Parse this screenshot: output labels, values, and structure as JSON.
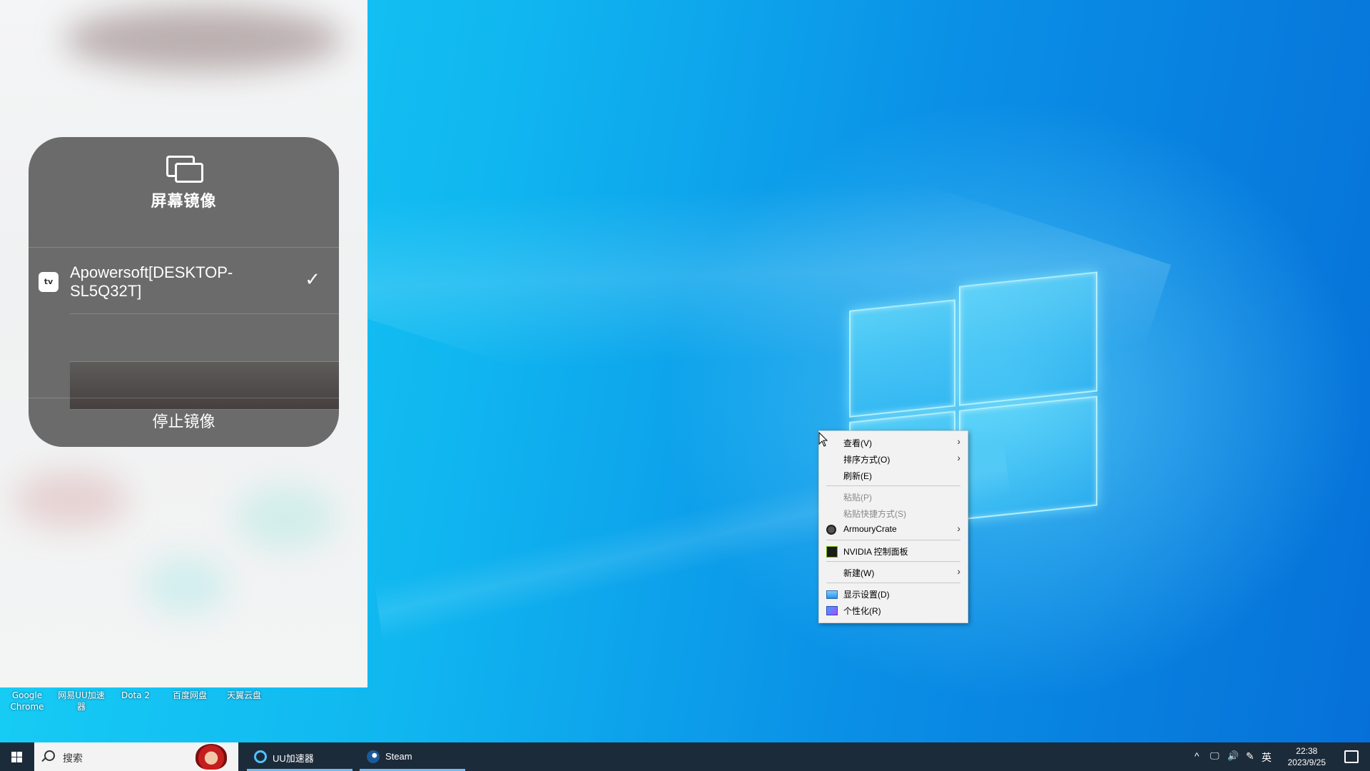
{
  "mirroring": {
    "title": "屏幕镜像",
    "tv_badge": "tv",
    "device_name": "Apowersoft[DESKTOP-SL5Q32T]",
    "check": "✓",
    "stop_label": "停止镜像"
  },
  "desktop_icons": [
    {
      "label": "Google\nChrome"
    },
    {
      "label": "网易UU加速\n器"
    },
    {
      "label": "Dota 2"
    },
    {
      "label": "百度网盘"
    },
    {
      "label": "天翼云盘"
    }
  ],
  "context_menu": {
    "items": [
      {
        "label": "查看(V)",
        "submenu": true,
        "enabled": true
      },
      {
        "label": "排序方式(O)",
        "submenu": true,
        "enabled": true
      },
      {
        "label": "刷新(E)",
        "submenu": false,
        "enabled": true
      },
      {
        "label": "粘贴(P)",
        "submenu": false,
        "enabled": false
      },
      {
        "label": "粘贴快捷方式(S)",
        "submenu": false,
        "enabled": false
      },
      {
        "label": "ArmouryCrate",
        "submenu": true,
        "enabled": true,
        "icon": "armourycrate-icon"
      },
      {
        "label": "NVIDIA 控制面板",
        "submenu": false,
        "enabled": true,
        "icon": "nvidia-icon"
      },
      {
        "label": "新建(W)",
        "submenu": true,
        "enabled": true
      },
      {
        "label": "显示设置(D)",
        "submenu": false,
        "enabled": true,
        "icon": "display-icon"
      },
      {
        "label": "个性化(R)",
        "submenu": false,
        "enabled": true,
        "icon": "personalize-icon"
      }
    ],
    "arrow": "›"
  },
  "taskbar": {
    "search_placeholder": "搜索",
    "apps": [
      {
        "label": "UU加速器",
        "icon": "uu-icon"
      },
      {
        "label": "Steam",
        "icon": "steam-icon"
      }
    ],
    "tray": {
      "chevron": "^",
      "network": "🖵",
      "volume": "🔊",
      "pen": "✎",
      "ime": "英"
    },
    "time": "22:38",
    "date": "2023/9/25"
  },
  "colors": {
    "desktop_bg": "#10b6f0",
    "taskbar_bg": "#1c2b3a",
    "mirror_card_bg": "#6b6b6b",
    "menu_bg": "#f2f2f2",
    "taskbar_accent": "#76b9ed"
  }
}
